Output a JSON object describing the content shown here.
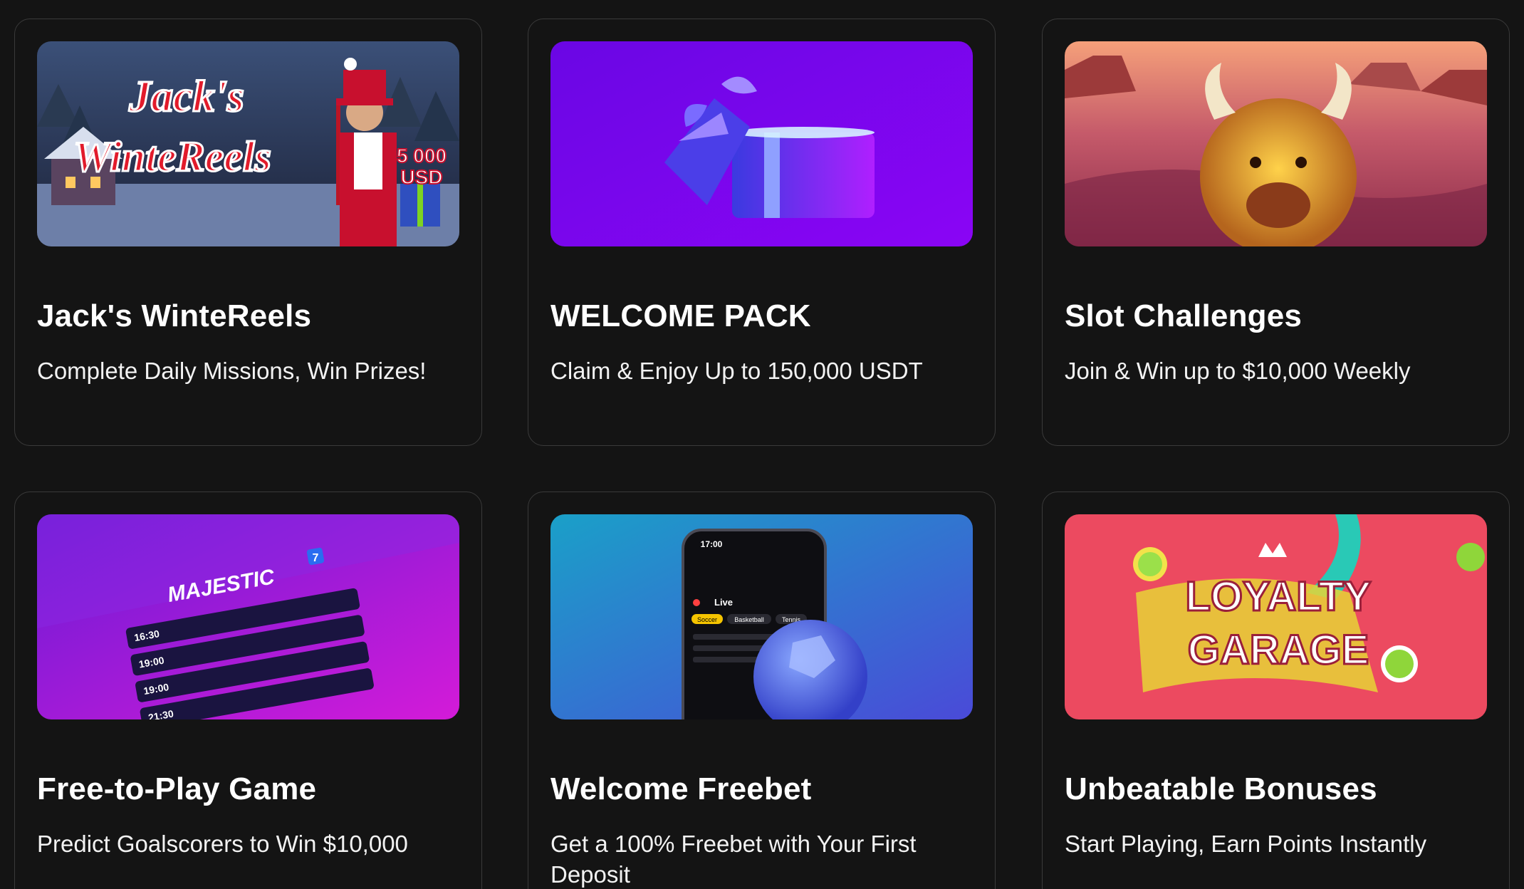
{
  "promotions": [
    {
      "title": "Jack's WinteReels",
      "subtitle": "Complete Daily Missions, Win Prizes!",
      "banner_text": [
        "Jack's",
        "WinteReels",
        "5 000",
        "USD"
      ],
      "banner_icon": "santa-character-banner"
    },
    {
      "title": "WELCOME PACK",
      "subtitle": "Claim & Enjoy Up to 150,000 USDT",
      "banner_icon": "gift-box-banner"
    },
    {
      "title": "Slot Challenges",
      "subtitle": "Join & Win up to $10,000 Weekly",
      "banner_icon": "buffalo-canyon-banner"
    },
    {
      "title": "Free-to-Play Game",
      "subtitle": "Predict Goalscorers to Win $10,000",
      "banner_text": [
        "MAJESTIC",
        "7",
        "16:30",
        "19:00",
        "19:00",
        "21:30"
      ],
      "banner_icon": "match-schedule-banner"
    },
    {
      "title": "Welcome Freebet",
      "subtitle": "Get a 100% Freebet with Your First Deposit",
      "banner_text": [
        "17:00",
        "Live",
        "Soccer",
        "Basketball",
        "Tennis"
      ],
      "banner_icon": "phone-soccer-banner"
    },
    {
      "title": "Unbeatable Bonuses",
      "subtitle": "Start Playing, Earn Points Instantly",
      "banner_text": [
        "LOYALTY",
        "GARAGE"
      ],
      "banner_icon": "loyalty-garage-banner"
    }
  ],
  "colors": {
    "background": "#141414",
    "card_border": "#3a3a3a",
    "text": "#ffffff"
  }
}
